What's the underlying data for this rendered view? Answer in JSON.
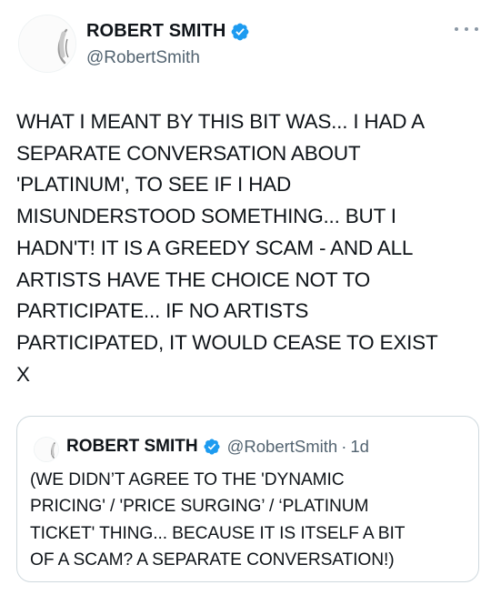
{
  "tweet": {
    "author": {
      "display_name": "ROBERT SMITH",
      "handle": "@RobertSmith",
      "verified_icon": "verified-badge-icon",
      "avatar_icon": "profile-avatar"
    },
    "more_icon": "more-options-icon",
    "text": "WHAT I MEANT BY THIS BIT WAS... I HAD A\nSEPARATE CONVERSATION ABOUT\n'PLATINUM', TO SEE IF I HAD\nMISUNDERSTOOD SOMETHING... BUT I\nHADN'T! IT IS A GREEDY SCAM - AND ALL\nARTISTS HAVE THE CHOICE NOT TO\nPARTICIPATE... IF NO ARTISTS\nPARTICIPATED, IT WOULD CEASE TO EXIST\nX"
  },
  "quoted_tweet": {
    "author": {
      "display_name": "ROBERT SMITH",
      "handle": "@RobertSmith",
      "separator": "·",
      "time": "1d"
    },
    "text": "(WE DIDN’T AGREE TO THE 'DYNAMIC\nPRICING' / 'PRICE SURGING’ / ‘PLATINUM\nTICKET' THING... BECAUSE IT IS ITSELF A BIT\nOF A SCAM? A SEPARATE CONVERSATION!)"
  },
  "colors": {
    "text": "#0f1419",
    "secondary_text": "#536471",
    "verified_blue": "#1d9bf0",
    "border": "#cfd9de"
  }
}
